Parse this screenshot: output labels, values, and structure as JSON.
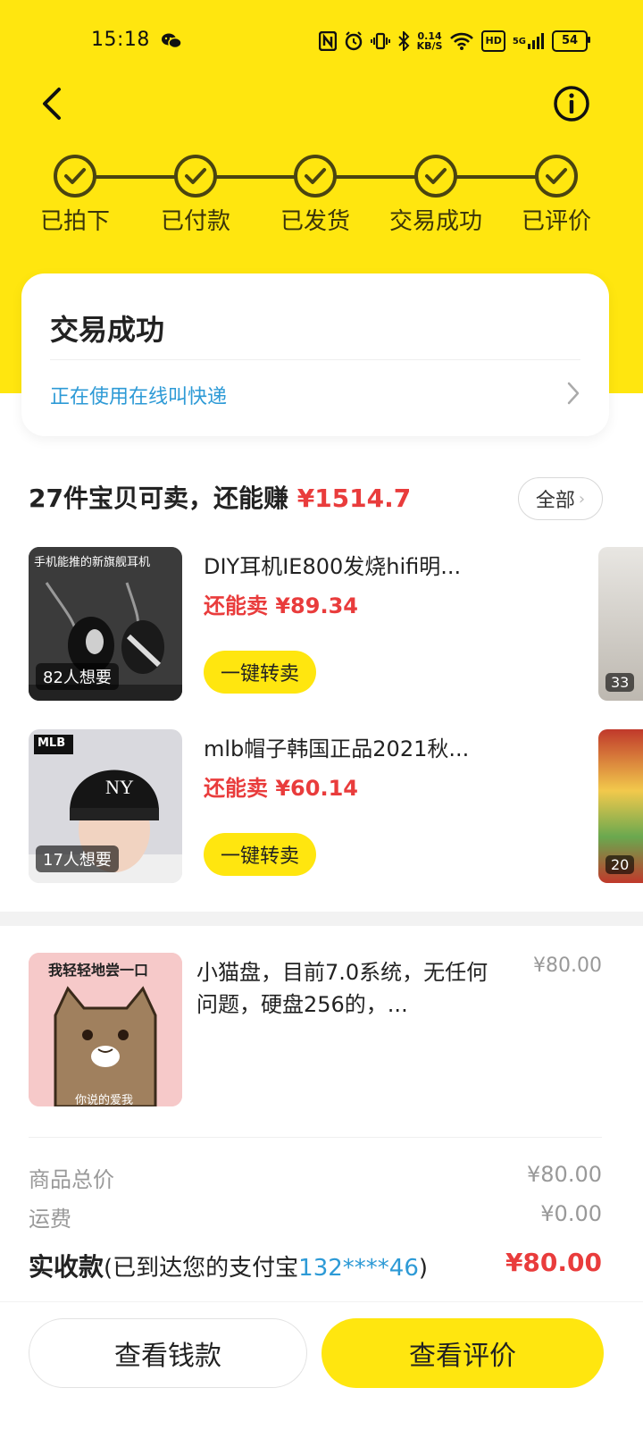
{
  "status_bar": {
    "time": "15:18",
    "net_speed_value": "0.14",
    "net_speed_unit": "KB/S",
    "network": "5G",
    "hd_label": "HD",
    "battery": "54"
  },
  "header": {
    "back_icon": "chevron-left-icon",
    "info_icon": "info-circle-icon"
  },
  "progress_steps": [
    {
      "label": "已拍下",
      "done": true
    },
    {
      "label": "已付款",
      "done": true
    },
    {
      "label": "已发货",
      "done": true
    },
    {
      "label": "交易成功",
      "done": true
    },
    {
      "label": "已评价",
      "done": true
    }
  ],
  "status_card": {
    "title": "交易成功",
    "link_text": "正在使用在线叫快递"
  },
  "resell_section": {
    "heading_prefix": "27件宝贝可卖，还能赚 ",
    "heading_amount": "¥1514.7",
    "all_button": "全部",
    "items": [
      {
        "title": "DIY耳机IE800发烧hifi明...",
        "price": "还能卖 ¥89.34",
        "wants": "82人想要",
        "thumb_caption": "手机能推的新旗舰耳机",
        "button": "一键转卖",
        "peek_badge": "33"
      },
      {
        "title": "mlb帽子韩国正品2021秋...",
        "price": "还能卖 ¥60.14",
        "wants": "17人想要",
        "thumb_caption": "MLB",
        "button": "一键转卖",
        "peek_badge": "20"
      }
    ]
  },
  "order": {
    "thumb_caption_top": "我轻轻地尝一口",
    "thumb_caption_bottom": "你说的爱我",
    "title": "小猫盘，目前7.0系统，无任何问题，硬盘256的，...",
    "price": "¥80.00"
  },
  "summary": {
    "goods_label": "商品总价",
    "goods_value": "¥80.00",
    "shipping_label": "运费",
    "shipping_value": "¥0.00",
    "received_label": "实收款",
    "received_note_prefix": "(已到达您的支付宝",
    "received_account": "132****46",
    "received_note_suffix": ")",
    "received_value": "¥80.00"
  },
  "bottom_bar": {
    "wallet_button": "查看钱款",
    "review_button": "查看评价"
  },
  "colors": {
    "brand_yellow": "#ffe60f",
    "price_red": "#e93c3c",
    "link_blue": "#2d9ad6"
  }
}
